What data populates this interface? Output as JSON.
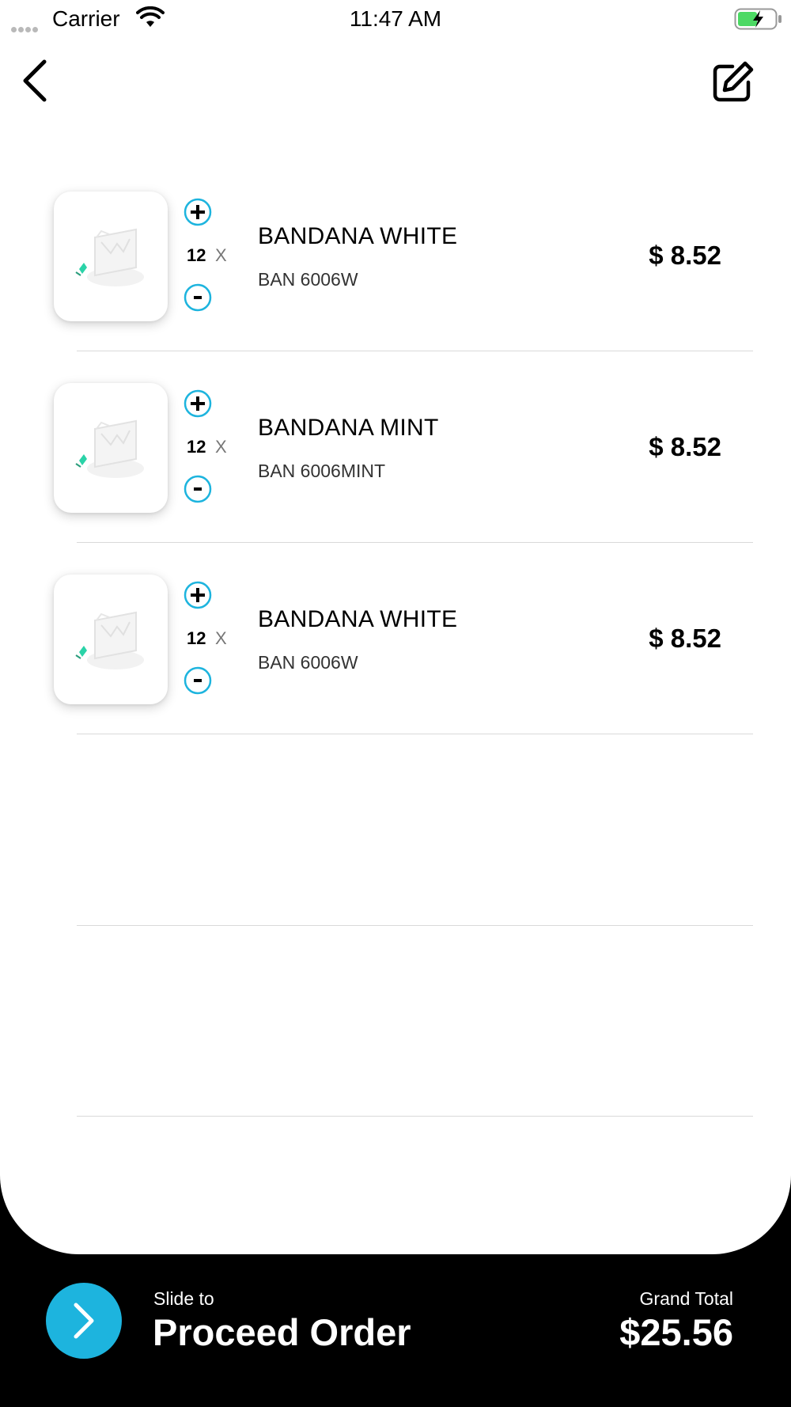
{
  "status_bar": {
    "carrier": "Carrier",
    "time": "11:47 AM"
  },
  "header": {
    "back_icon": "chevron-left-icon",
    "edit_icon": "edit-icon"
  },
  "cart": {
    "items": [
      {
        "quantity": "12",
        "times": "X",
        "name": "BANDANA WHITE",
        "sku": "BAN 6006W",
        "price": "$ 8.52"
      },
      {
        "quantity": "12",
        "times": "X",
        "name": "BANDANA MINT",
        "sku": "BAN 6006MINT",
        "price": "$ 8.52"
      },
      {
        "quantity": "12",
        "times": "X",
        "name": "BANDANA WHITE",
        "sku": "BAN 6006W",
        "price": "$ 8.52"
      }
    ]
  },
  "footer": {
    "slide_to": "Slide to",
    "proceed": "Proceed Order",
    "grand_total_label": "Grand Total",
    "grand_total_value": "$25.56"
  },
  "colors": {
    "accent": "#1db4de",
    "footer_bg": "#000000",
    "battery_green": "#4cd964"
  }
}
